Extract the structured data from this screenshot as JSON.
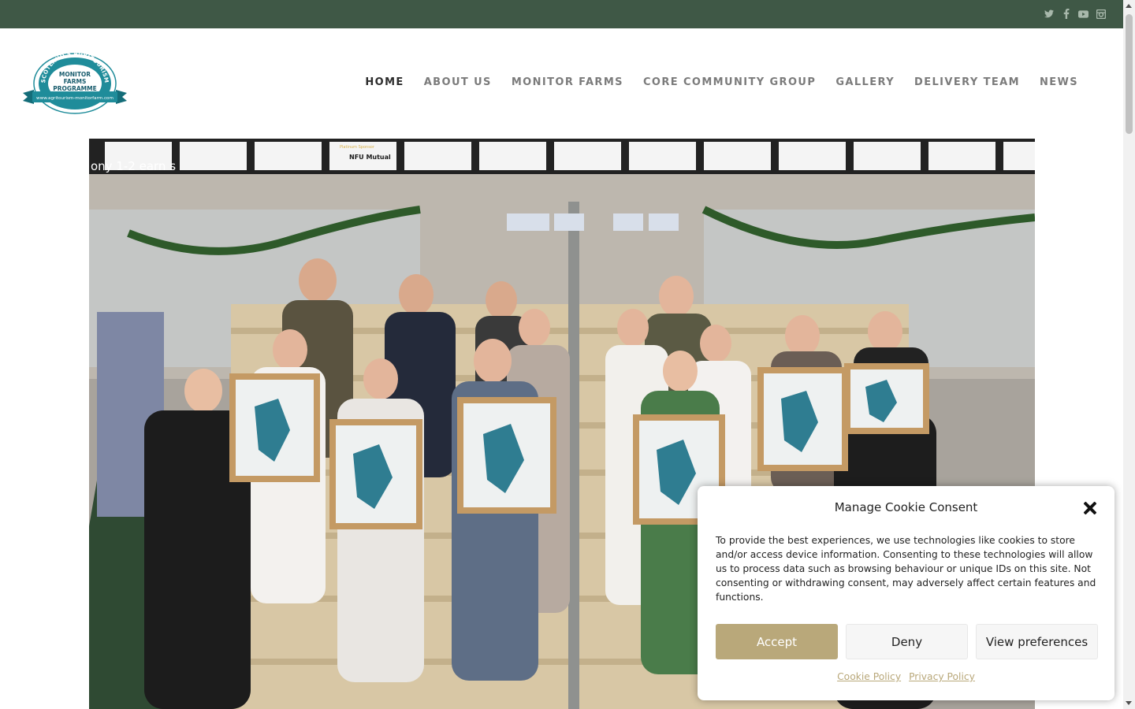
{
  "social": [
    {
      "name": "twitter-icon",
      "glyph": "🐦"
    },
    {
      "name": "facebook-icon",
      "glyph": "f"
    },
    {
      "name": "youtube-icon",
      "glyph": "▶"
    },
    {
      "name": "instagram-icon",
      "glyph": "◘"
    }
  ],
  "logo": {
    "arc_text": "SCOTLAND'S AGRITOURISM",
    "line1": "MONITOR",
    "line2": "FARMS",
    "line3": "PROGRAMME",
    "url": "www.agritourism-monitorfarm.com"
  },
  "nav": {
    "home": "HOME",
    "about": "ABOUT US",
    "monitor_farms": "MONITOR FARMS",
    "core_group": "CORE COMMUNITY GROUP",
    "gallery": "GALLERY",
    "delivery_team": "DELIVERY TEAM",
    "news": "NEWS"
  },
  "hero": {
    "banner_brand": "NFU Mutual",
    "banner_sponsor": "Platinum Sponsor",
    "sign_text": "ony 1-2\nearn\ns"
  },
  "cookie": {
    "title": "Manage Cookie Consent",
    "body": "To provide the best experiences, we use technologies like cookies to store and/or access device information. Consenting to these technologies will allow us to process data such as browsing behaviour or unique IDs on this site. Not consenting or withdrawing consent, may adversely affect certain features and functions.",
    "accept": "Accept",
    "deny": "Deny",
    "preferences": "View preferences",
    "cookie_policy": "Cookie Policy",
    "privacy_policy": "Privacy Policy"
  },
  "colors": {
    "topbar": "#3f5846",
    "accent": "#b9a87a",
    "logo_teal": "#1f8c9a"
  }
}
